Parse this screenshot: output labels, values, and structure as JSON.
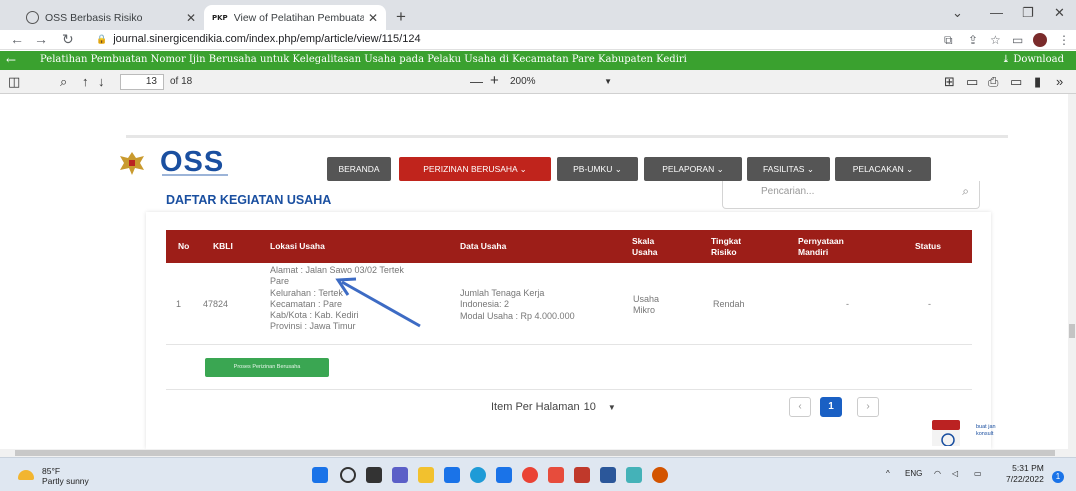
{
  "browser": {
    "tabs": [
      {
        "label": "OSS Berbasis Risiko",
        "active": false
      },
      {
        "label": "View of Pelatihan Pembuatan No",
        "favicon_text": "PKP",
        "active": true
      }
    ],
    "url": "journal.sinergicendikia.com/index.php/emp/article/view/115/124"
  },
  "article_bar": {
    "title": "Pelatihan Pembuatan Nomor Ijin Berusaha untuk Kelegalitasan Usaha pada Pelaku Usaha di Kecamatan Pare Kabupaten Kediri",
    "download_label": "Download",
    "color": "#3aa12f"
  },
  "pdf_toolbar": {
    "page_current": "13",
    "page_total": "of 18",
    "zoom": "200%"
  },
  "oss": {
    "logo_text": "OSS",
    "nav": [
      {
        "label": "BERANDA",
        "active": false
      },
      {
        "label": "PERIZINAN BERUSAHA",
        "active": true,
        "caret": "⌄"
      },
      {
        "label": "PB-UMKU",
        "active": false,
        "caret": "⌄"
      },
      {
        "label": "PELAPORAN",
        "active": false,
        "caret": "⌄"
      },
      {
        "label": "FASILITAS",
        "active": false,
        "caret": "⌄"
      },
      {
        "label": "PELACAKAN",
        "active": false,
        "caret": "⌄"
      }
    ],
    "section_title": "DAFTAR KEGIATAN USAHA",
    "search_placeholder": "Pencarian...",
    "table": {
      "headers": [
        "No",
        "KBLI",
        "Lokasi Usaha",
        "Data Usaha",
        "Skala Usaha",
        "Tingkat Risiko",
        "Pernyataan Mandiri",
        "Status"
      ],
      "rows": [
        {
          "no": "1",
          "kbli": "47824",
          "lokasi": [
            "Alamat : Jalan Sawo 03/02 Tertek",
            "Pare",
            "Kelurahan : Tertek",
            "Kecamatan : Pare",
            "Kab/Kota : Kab. Kediri",
            "Provinsi : Jawa Timur"
          ],
          "data_usaha": [
            "Jumlah Tenaga Kerja",
            "Indonesia: 2",
            "Modal Usaha : Rp 4.000.000"
          ],
          "skala": [
            "Usaha",
            "Mikro"
          ],
          "risiko": "Rendah",
          "pernyataan": "-",
          "status": "-"
        }
      ]
    },
    "proses_button": "Proses Perizinan Berusaha",
    "pagination": {
      "per_page_label": "Item Per Halaman",
      "per_page_value": "10",
      "prev": "‹",
      "current": "1",
      "next": "›"
    },
    "chat_text": [
      "buat jan",
      "konsult"
    ],
    "colors": {
      "brand_red": "#c0241c",
      "header_red": "#9d1e18",
      "brand_blue": "#1a4fa0",
      "green": "#3aa652"
    }
  },
  "taskbar": {
    "temperature": "85°F",
    "weather": "Partly sunny",
    "language": "ENG",
    "time": "5:31 PM",
    "date": "7/22/2022",
    "notifications": "1"
  }
}
